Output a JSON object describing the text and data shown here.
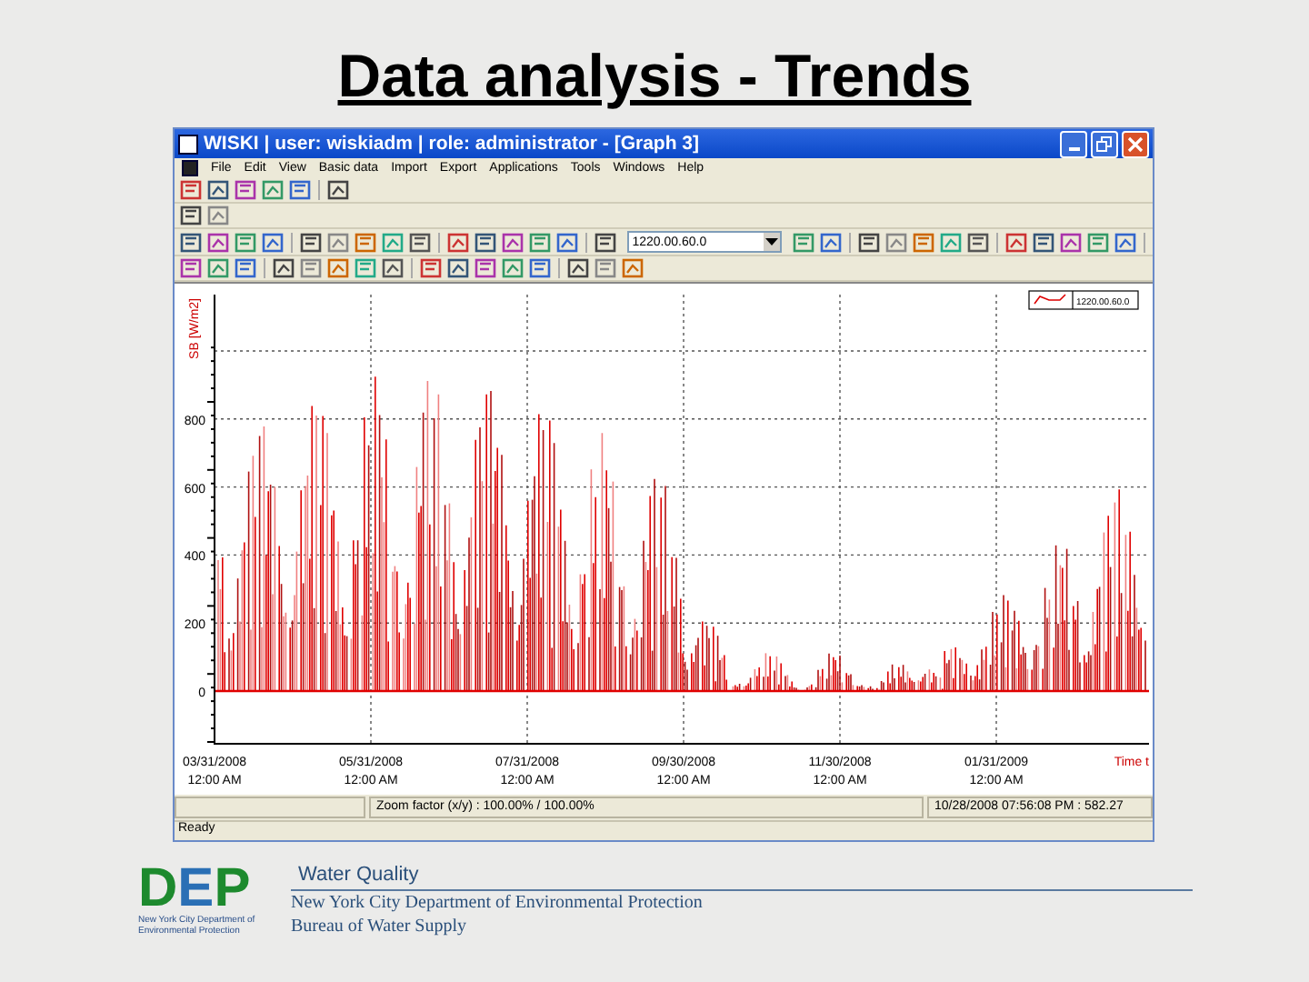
{
  "slide_title": "Data analysis - Trends",
  "window": {
    "title": "WISKI | user: wiskiadm | role: administrator - [Graph 3]"
  },
  "menu": [
    "File",
    "Edit",
    "View",
    "Basic data",
    "Import",
    "Export",
    "Applications",
    "Tools",
    "Windows",
    "Help"
  ],
  "toolbar": {
    "series_field": "1220.00.60.0"
  },
  "graph": {
    "y_axis_title": "SB [W/m2]",
    "y_labels": [
      "800",
      "600",
      "400",
      "200",
      "0"
    ],
    "x_labels": [
      {
        "date": "03/31/2008",
        "time": "12:00 AM"
      },
      {
        "date": "05/31/2008",
        "time": "12:00 AM"
      },
      {
        "date": "07/31/2008",
        "time": "12:00 AM"
      },
      {
        "date": "09/30/2008",
        "time": "12:00 AM"
      },
      {
        "date": "11/30/2008",
        "time": "12:00 AM"
      },
      {
        "date": "01/31/2009",
        "time": "12:00 AM"
      }
    ],
    "x_axis_title": "Time t",
    "legend": "1220.00.60.0"
  },
  "status": {
    "zoom": "Zoom factor (x/y) :  100.00% / 100.00%",
    "cursor": "10/28/2008 07:56:08 PM : 582.27",
    "state": "Ready"
  },
  "footer": {
    "logo_letters": [
      "D",
      "E",
      "P"
    ],
    "logo_caption": "New York City Department of Environmental Protection",
    "heading": "Water Quality",
    "lines": [
      "New York City Department of Environmental Protection",
      "Bureau of Water Supply"
    ]
  }
}
